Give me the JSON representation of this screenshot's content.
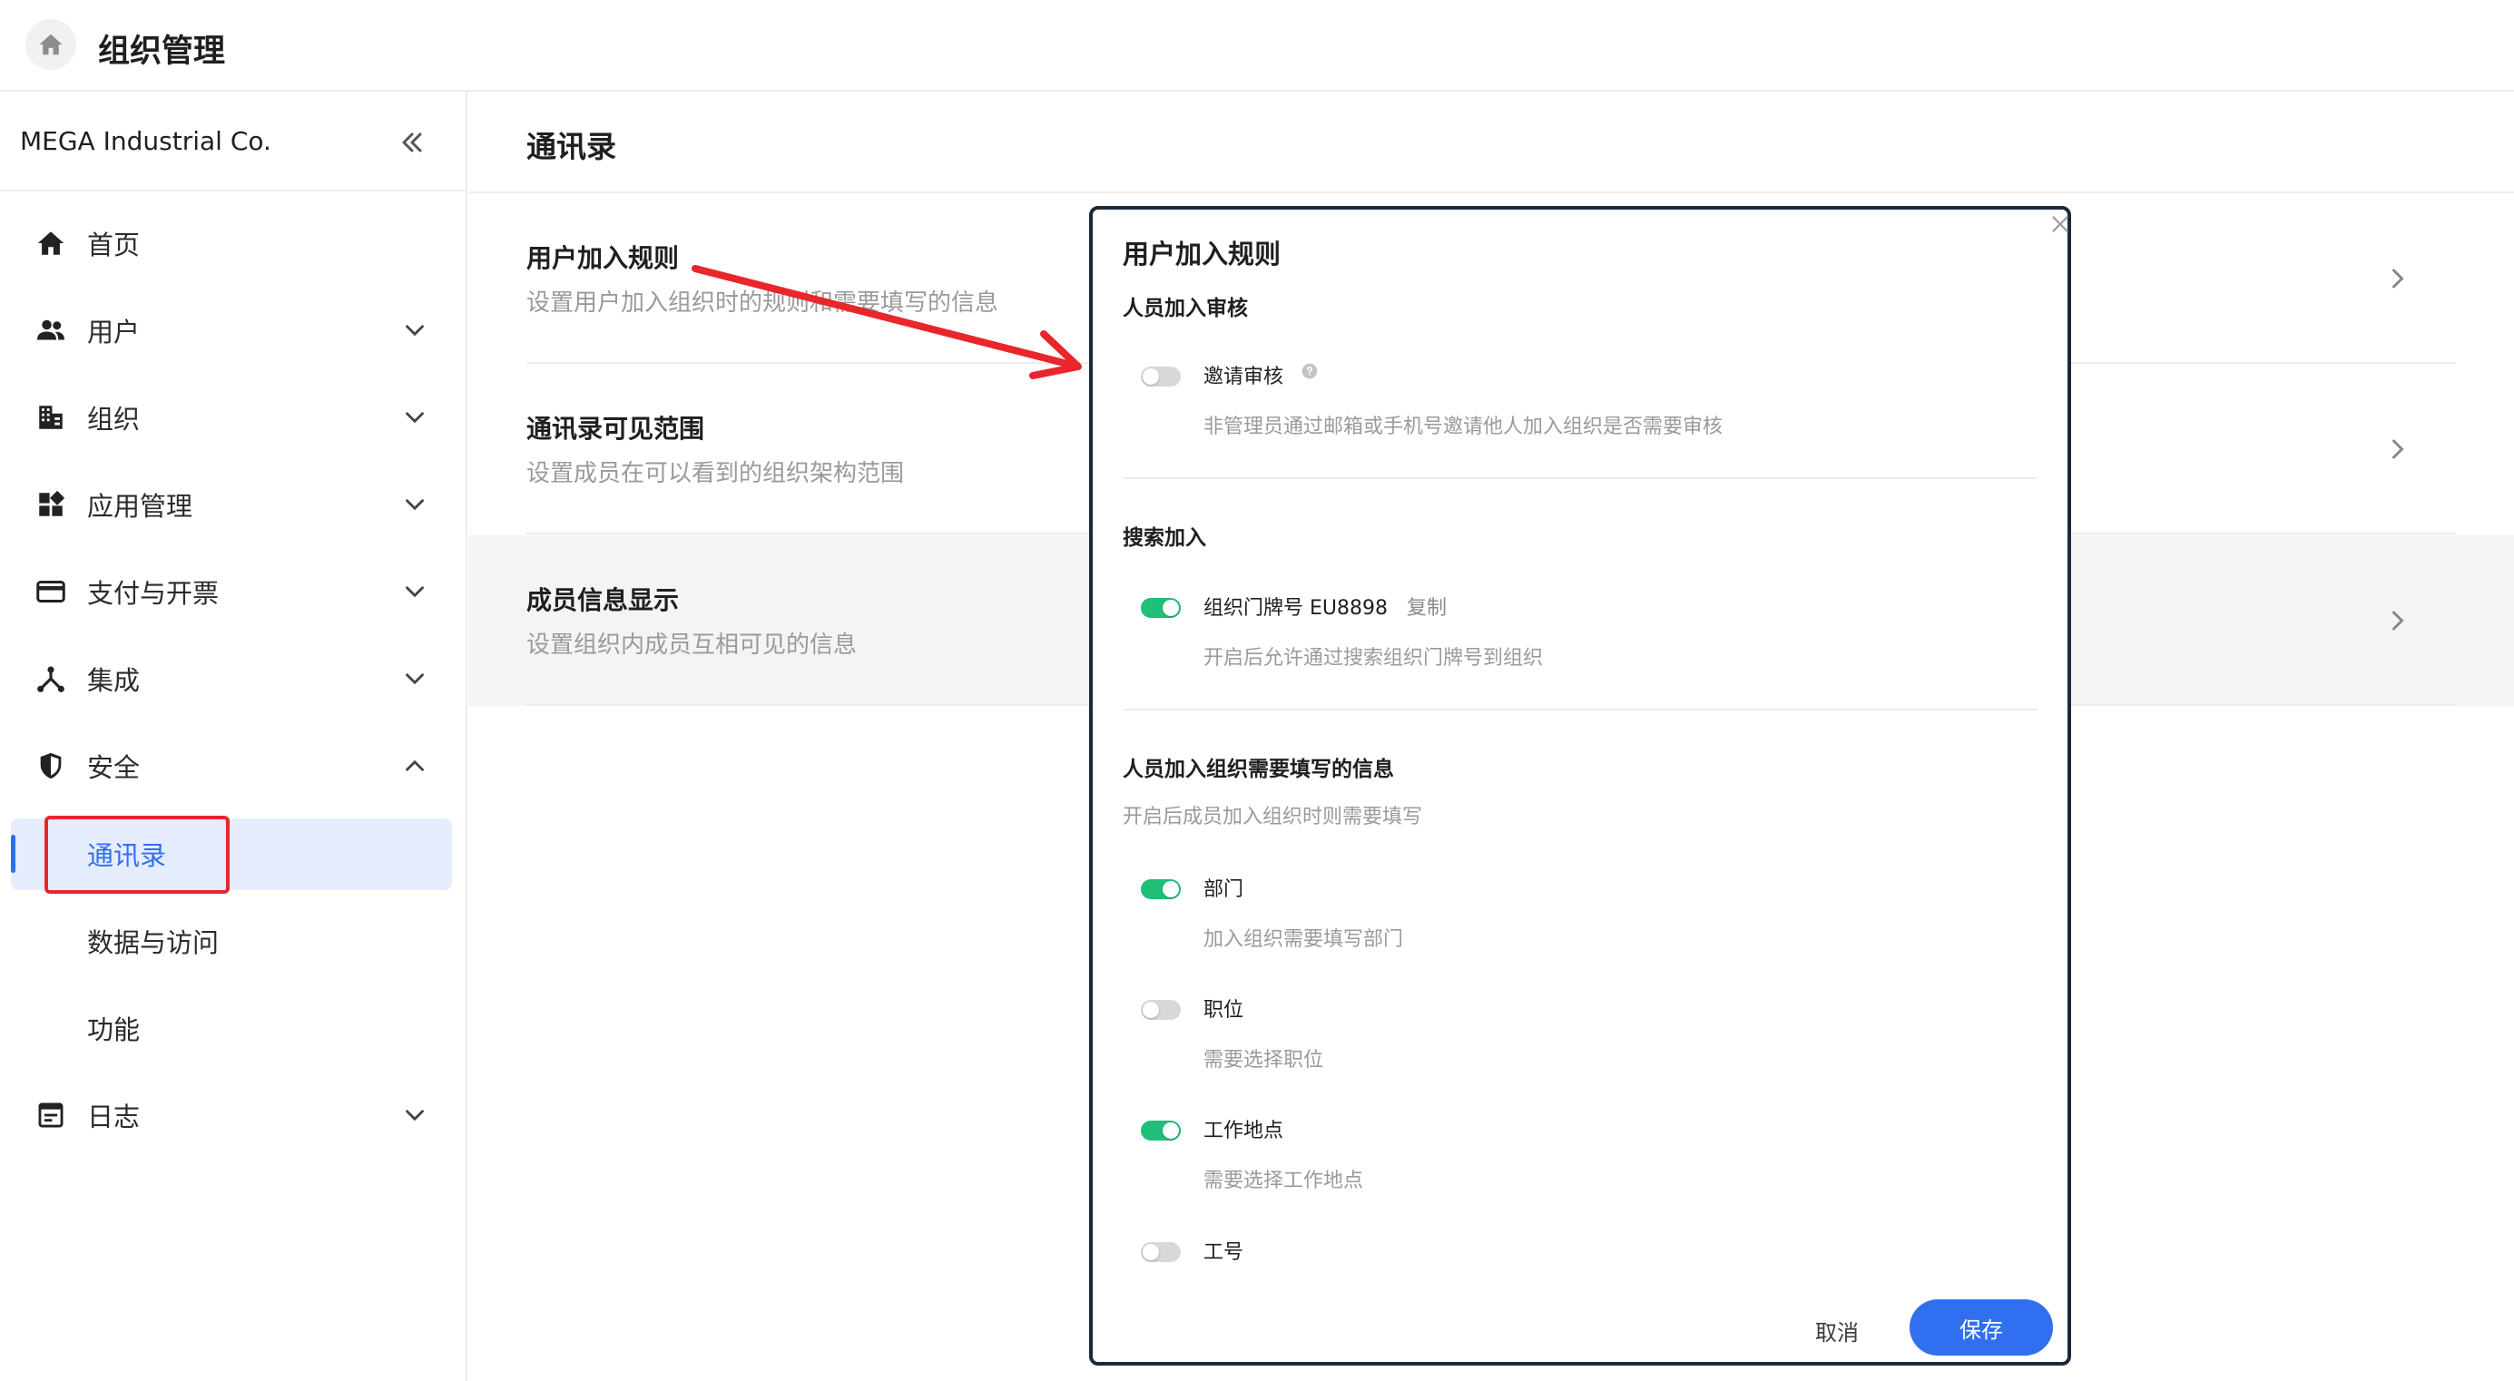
{
  "header": {
    "title": "组织管理",
    "home_icon": "home-icon"
  },
  "sidebar": {
    "org_name": "MEGA Industrial Co.",
    "collapse_icon": "double-chevron-left-icon",
    "items": [
      {
        "label": "首页",
        "icon": "home-icon",
        "expandable": false
      },
      {
        "label": "用户",
        "icon": "users-icon",
        "expandable": true
      },
      {
        "label": "组织",
        "icon": "building-icon",
        "expandable": true
      },
      {
        "label": "应用管理",
        "icon": "apps-icon",
        "expandable": true
      },
      {
        "label": "支付与开票",
        "icon": "credit-card-icon",
        "expandable": true
      },
      {
        "label": "集成",
        "icon": "integration-icon",
        "expandable": true
      },
      {
        "label": "安全",
        "icon": "shield-icon",
        "expandable": true,
        "expanded": true
      },
      {
        "label": "日志",
        "icon": "log-icon",
        "expandable": true
      }
    ],
    "security_sub": [
      "通讯录",
      "数据与访问",
      "功能"
    ],
    "active_sub": "通讯录",
    "accent": "#2f6ff0"
  },
  "main": {
    "title": "通讯录",
    "rows": [
      {
        "title": "用户加入规则",
        "desc": "设置用户加入组织时的规则和需要填写的信息"
      },
      {
        "title": "通讯录可见范围",
        "desc": "设置成员在可以看到的组织架构范围"
      },
      {
        "title": "成员信息显示",
        "desc": "设置组织内成员互相可见的信息"
      }
    ]
  },
  "modal": {
    "title": "用户加入规则",
    "sections": {
      "review": {
        "title": "人员加入审核",
        "option": {
          "label": "邀请审核",
          "desc": "非管理员通过邮箱或手机号邀请他人加入组织是否需要审核",
          "on": false
        }
      },
      "search": {
        "title": "搜索加入",
        "option": {
          "label": "组织门牌号 EU8898",
          "copy": "复制",
          "desc": "开启后允许通过搜索组织门牌号到组织",
          "on": true
        }
      },
      "fields": {
        "title": "人员加入组织需要填写的信息",
        "desc": "开启后成员加入组织时则需要填写",
        "options": [
          {
            "label": "部门",
            "desc": "加入组织需要填写部门",
            "on": true
          },
          {
            "label": "职位",
            "desc": "需要选择职位",
            "on": false
          },
          {
            "label": "工作地点",
            "desc": "需要选择工作地点",
            "on": true
          },
          {
            "label": "工号",
            "desc": "",
            "on": false
          }
        ]
      }
    },
    "cancel": "取消",
    "save": "保存",
    "toggle_on_color": "#1fbf7a"
  },
  "annotation": {
    "color": "#e8262c"
  }
}
